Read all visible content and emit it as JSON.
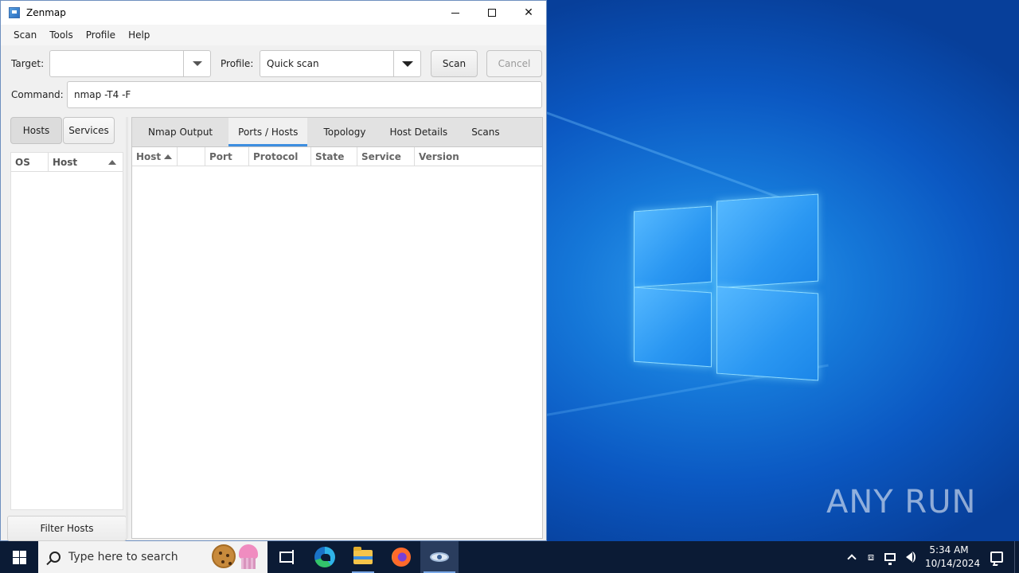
{
  "window": {
    "title": "Zenmap",
    "menu": [
      "Scan",
      "Tools",
      "Profile",
      "Help"
    ]
  },
  "toolbar": {
    "target_label": "Target:",
    "target_value": "",
    "profile_label": "Profile:",
    "profile_value": "Quick scan",
    "scan_button": "Scan",
    "cancel_button": "Cancel",
    "command_label": "Command:",
    "command_value": "nmap -T4 -F"
  },
  "left_pane": {
    "tabs": [
      "Hosts",
      "Services"
    ],
    "active_tab": "Hosts",
    "columns": [
      "OS",
      "Host"
    ],
    "filter_button": "Filter Hosts"
  },
  "main": {
    "tabs": [
      "Nmap Output",
      "Ports / Hosts",
      "Topology",
      "Host Details",
      "Scans"
    ],
    "active_tab": "Ports / Hosts",
    "columns": [
      "Host",
      "",
      "Port",
      "Protocol",
      "State",
      "Service",
      "Version"
    ]
  },
  "taskbar": {
    "search_placeholder": "Type here to search",
    "time": "5:34 AM",
    "date": "10/14/2024"
  },
  "desktop": {
    "watermark": "ANY RUN"
  },
  "colors": {
    "accent": "#3d8ee0",
    "taskbar": "#0b1b35",
    "desktop": "#0b58c2"
  }
}
